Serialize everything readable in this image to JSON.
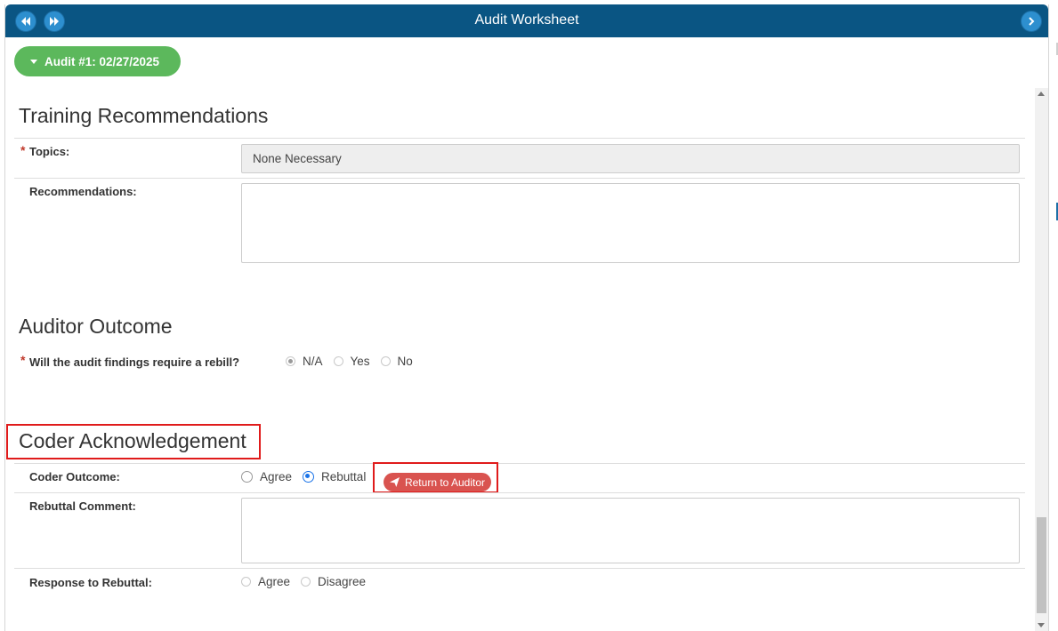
{
  "window": {
    "title": "Audit Worksheet"
  },
  "audit_pill": {
    "label": "Audit #1: 02/27/2025"
  },
  "training": {
    "heading": "Training Recommendations",
    "topics_label": "Topics:",
    "topics_value": "None Necessary",
    "recommendations_label": "Recommendations:",
    "recommendations_value": ""
  },
  "auditor": {
    "heading": "Auditor Outcome",
    "rebill_label": "Will the audit findings require a rebill?",
    "options": [
      "N/A",
      "Yes",
      "No"
    ],
    "selected": "N/A"
  },
  "coder": {
    "heading": "Coder Acknowledgement",
    "outcome_label": "Coder Outcome:",
    "outcome_options": [
      "Agree",
      "Rebuttal"
    ],
    "outcome_selected": "Rebuttal",
    "return_button": "Return to Auditor",
    "rebuttal_label": "Rebuttal Comment:",
    "rebuttal_value": "",
    "response_label": "Response to Rebuttal:",
    "response_options": [
      "Agree",
      "Disagree"
    ]
  },
  "required_marker": "*",
  "colors": {
    "titlebar": "#0a5583",
    "pill": "#5cb85c",
    "return_button": "#d9534f",
    "highlight": "#e01b1b",
    "required": "#c0392b"
  }
}
